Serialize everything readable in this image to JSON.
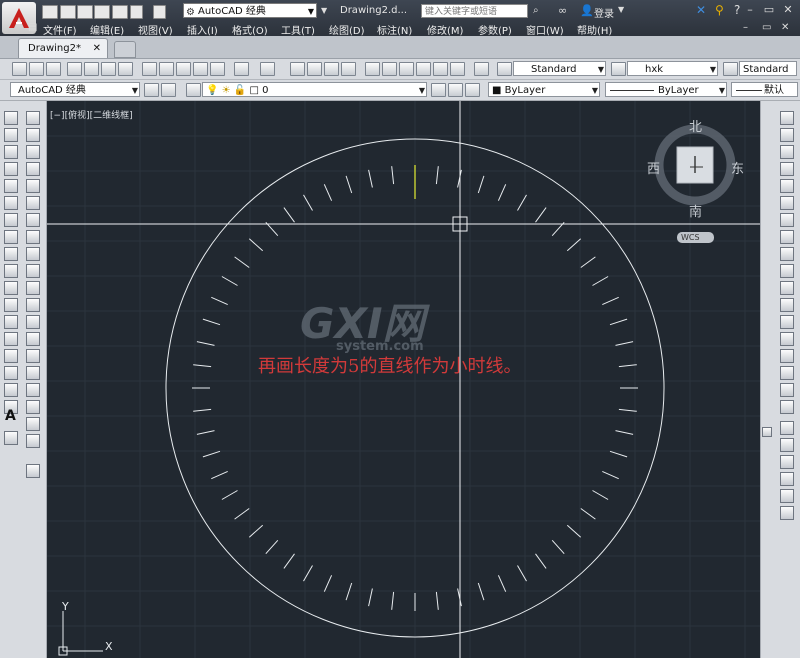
{
  "title_bar": {
    "workspace": "AutoCAD 经典",
    "document_title": "Drawing2.d...",
    "search_placeholder": "键入关键字或短语",
    "login": "登录",
    "window_controls": [
      "minimize-icon",
      "restore-icon",
      "close-icon"
    ]
  },
  "menu": [
    "文件(F)",
    "编辑(E)",
    "视图(V)",
    "插入(I)",
    "格式(O)",
    "工具(T)",
    "绘图(D)",
    "标注(N)",
    "修改(M)",
    "参数(P)",
    "窗口(W)",
    "帮助(H)"
  ],
  "tabs": {
    "active": "Drawing2*"
  },
  "toolbar": {
    "text_style": "Standard",
    "dim_style": "hxk",
    "table_style": "Standard",
    "workspace": "AutoCAD 经典",
    "layer": "0",
    "color": "ByLayer",
    "linetype": "ByLayer",
    "lineweight": "默认"
  },
  "viewport": {
    "label": "[−][俯视][二维线框]",
    "caption": "再画长度为5的直线作为小时线。",
    "watermark_main": "GXI网",
    "watermark_sub": "system.com"
  },
  "viewcube": {
    "north": "北",
    "south": "南",
    "east": "东",
    "west": "西",
    "wcs": "WCS"
  },
  "ucs": {
    "x": "X",
    "y": "Y"
  },
  "colors": {
    "canvas": "#212830",
    "caption": "#d23a3a",
    "highlight_tick": "#c8d234",
    "geometry": "#e8ecef"
  }
}
